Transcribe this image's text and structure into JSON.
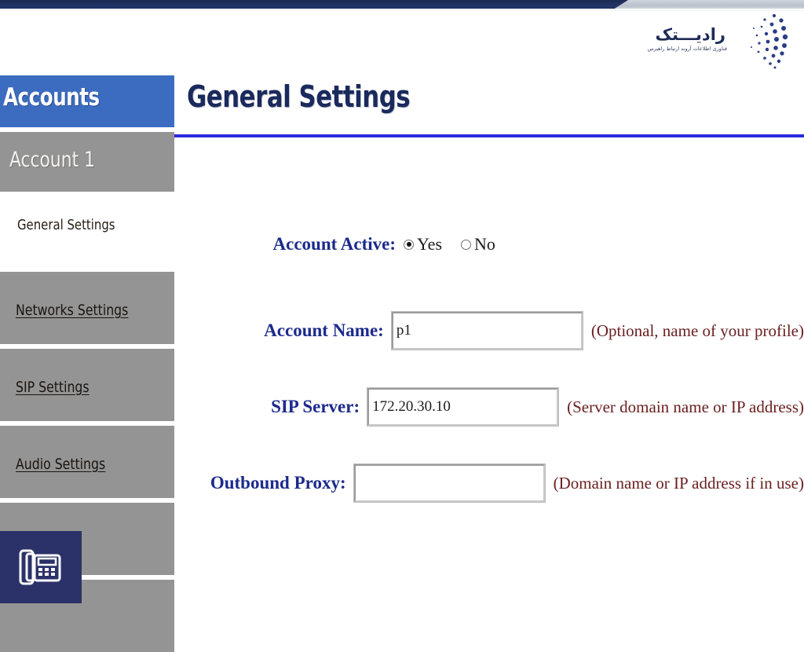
{
  "brand": {
    "logo_wordmark": "رادیـــتک",
    "logo_tagline": "فناوری اطلاعات آروند ارتباط راهبرس",
    "navy": "#1f2b57",
    "accent_blue": "#3c6cc0",
    "rule_blue": "#2a2ae0"
  },
  "sidebar": {
    "header_label": "Accounts",
    "items": [
      {
        "label": "Account 1",
        "type": "account",
        "state": "selected"
      },
      {
        "label": "General Settings",
        "type": "active",
        "state": "current"
      },
      {
        "label": "Networks Settings",
        "type": "link",
        "state": "normal"
      },
      {
        "label": "SIP Settings",
        "type": "link",
        "state": "normal"
      },
      {
        "label": "Audio Settings",
        "type": "link",
        "state": "normal"
      },
      {
        "label": "",
        "type": "blank",
        "state": "normal"
      }
    ],
    "phone_badge_icon": "desk-phone-icon"
  },
  "main": {
    "page_title": "General Settings",
    "fields": {
      "account_active": {
        "label": "Account Active:",
        "options": [
          {
            "label": "Yes",
            "checked": true
          },
          {
            "label": "No",
            "checked": false
          }
        ]
      },
      "account_name": {
        "label": "Account Name:",
        "value": "p1",
        "hint": "(Optional, name of your profile)"
      },
      "sip_server": {
        "label": "SIP Server:",
        "value": "172.20.30.10",
        "hint": "(Server domain name or IP address)"
      },
      "outbound_proxy": {
        "label": "Outbound Proxy:",
        "value": "",
        "hint": "(Domain name or IP address if in use)"
      }
    }
  }
}
